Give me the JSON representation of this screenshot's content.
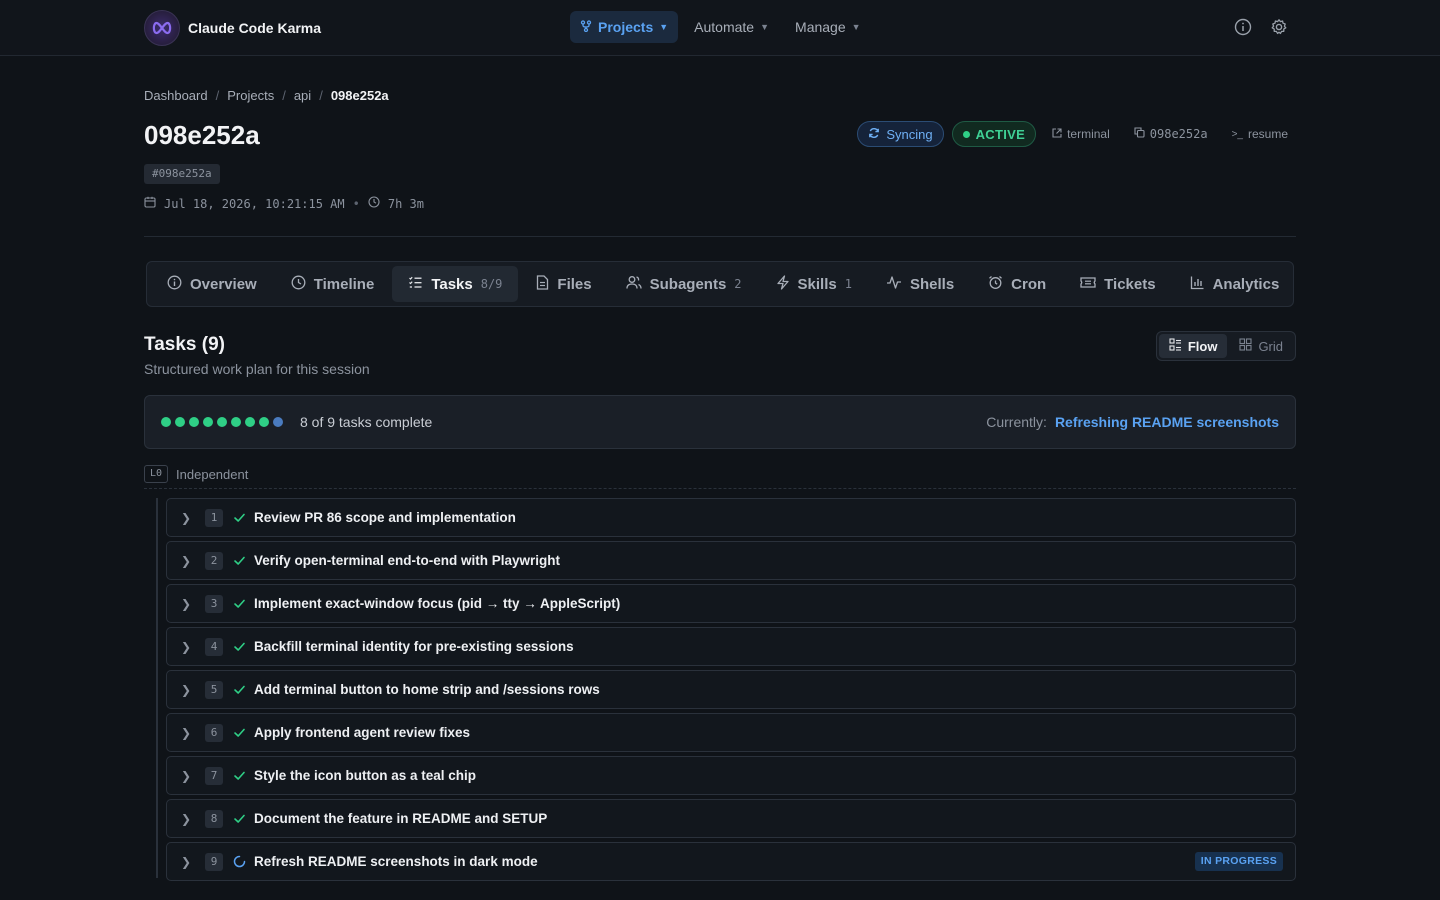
{
  "app": {
    "name": "Claude Code Karma"
  },
  "nav": {
    "items": [
      {
        "label": "Projects",
        "icon": "branch-icon",
        "active": true
      },
      {
        "label": "Automate",
        "active": false
      },
      {
        "label": "Manage",
        "active": false
      }
    ],
    "info_icon": "info-icon",
    "settings_icon": "gear-icon"
  },
  "breadcrumb": {
    "items": [
      "Dashboard",
      "Projects",
      "api"
    ],
    "current": "098e252a"
  },
  "session": {
    "title": "098e252a",
    "hash": "#098e252a",
    "date": "Jul 18, 2026, 10:21:15 AM",
    "duration": "7h 3m"
  },
  "actions": {
    "sync": "Syncing",
    "status": "ACTIVE",
    "terminal": "terminal",
    "copy_id": "098e252a",
    "resume": "resume"
  },
  "tabs": [
    {
      "label": "Overview",
      "icon": "info-icon",
      "count": ""
    },
    {
      "label": "Timeline",
      "icon": "clock-icon",
      "count": ""
    },
    {
      "label": "Tasks",
      "icon": "list-icon",
      "count": "8/9",
      "selected": true
    },
    {
      "label": "Files",
      "icon": "file-icon",
      "count": ""
    },
    {
      "label": "Subagents",
      "icon": "users-icon",
      "count": "2"
    },
    {
      "label": "Skills",
      "icon": "bolt-icon",
      "count": "1"
    },
    {
      "label": "Shells",
      "icon": "pulse-icon",
      "count": ""
    },
    {
      "label": "Cron",
      "icon": "alarm-icon",
      "count": ""
    },
    {
      "label": "Tickets",
      "icon": "ticket-icon",
      "count": ""
    },
    {
      "label": "Analytics",
      "icon": "bar-chart-icon",
      "count": ""
    }
  ],
  "tasks_section": {
    "title": "Tasks (9)",
    "subtitle": "Structured work plan for this session",
    "view": {
      "flow": "Flow",
      "grid": "Grid",
      "selected": "Flow"
    },
    "progress": {
      "completed": 8,
      "total": 9,
      "text": "8 of 9 tasks complete",
      "currently_label": "Currently:",
      "currently_value": "Refreshing README screenshots"
    },
    "level": {
      "chip": "L0",
      "label": "Independent"
    },
    "colors": {
      "done": "#2fcf86",
      "in_progress": "#5aa2f2"
    },
    "tasks": [
      {
        "num": "1",
        "label": "Review PR 86 scope and implementation",
        "status": "done",
        "badge": ""
      },
      {
        "num": "2",
        "label": "Verify open-terminal end-to-end with Playwright",
        "status": "done",
        "badge": ""
      },
      {
        "num": "3",
        "label": "Implement exact-window focus (pid → tty → AppleScript)",
        "status": "done",
        "badge": ""
      },
      {
        "num": "4",
        "label": "Backfill terminal identity for pre-existing sessions",
        "status": "done",
        "badge": ""
      },
      {
        "num": "5",
        "label": "Add terminal button to home strip and /sessions rows",
        "status": "done",
        "badge": ""
      },
      {
        "num": "6",
        "label": "Apply frontend agent review fixes",
        "status": "done",
        "badge": ""
      },
      {
        "num": "7",
        "label": "Style the icon button as a teal chip",
        "status": "done",
        "badge": ""
      },
      {
        "num": "8",
        "label": "Document the feature in README and SETUP",
        "status": "done",
        "badge": ""
      },
      {
        "num": "9",
        "label": "Refresh README screenshots in dark mode",
        "status": "in_progress",
        "badge": "IN PROGRESS"
      }
    ]
  }
}
